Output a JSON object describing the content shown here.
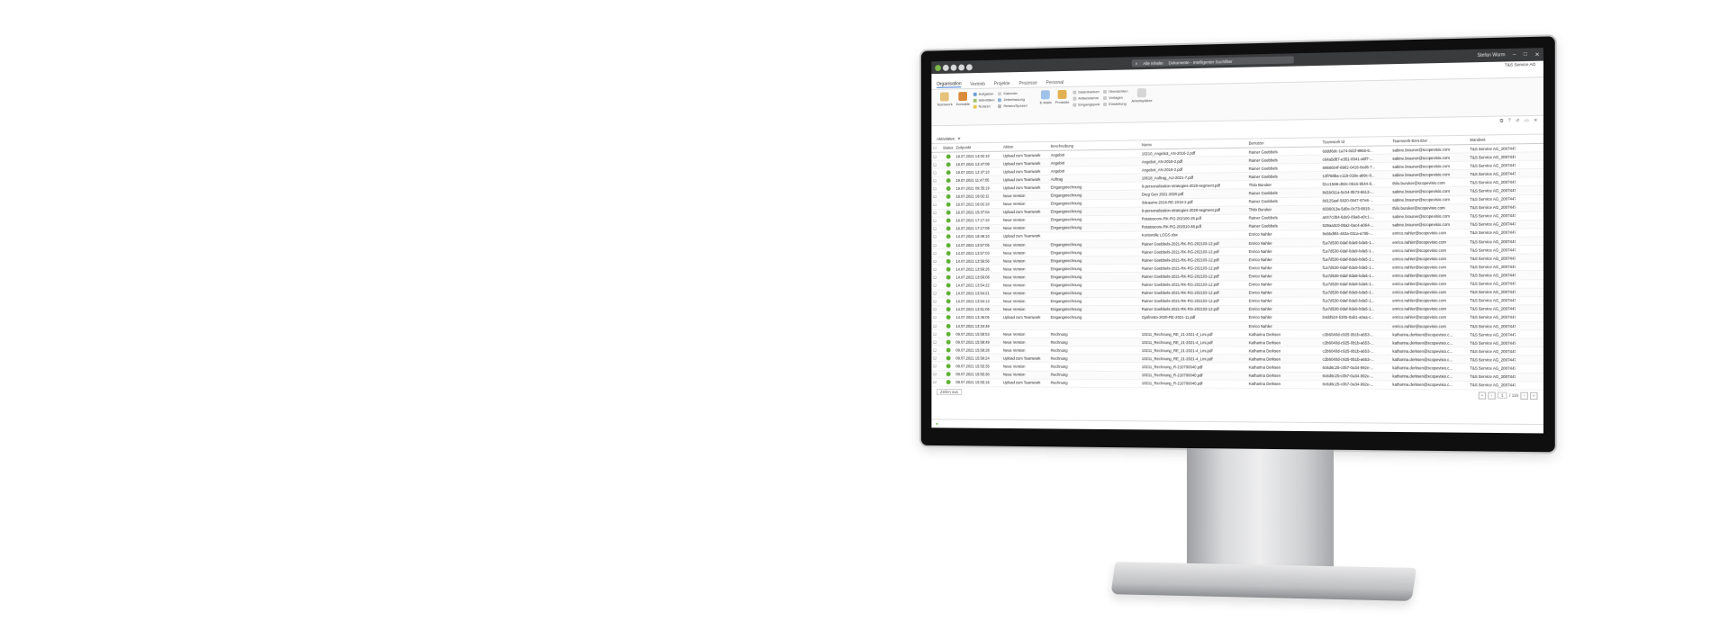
{
  "app": {
    "search_placeholder": "Alle Inhalte",
    "window_title": "Dokumente - Intelligenter Suchfilter",
    "user": "Stefan Wurm",
    "tenant": "T&S Service AG",
    "tabs": [
      "Organisation",
      "Vertrieb",
      "Projekte",
      "Prozesse",
      "Personal"
    ],
    "active_tab": "Organisation"
  },
  "ribbon": {
    "big1": "Teamwork",
    "big2": "Kontakte",
    "small_a": [
      "Aufgaben",
      "Aktivitäten",
      "Notizen"
    ],
    "small_b": [
      "Kalender",
      "Zeiterfassung",
      "Reisen/Spesen"
    ],
    "big3": "E-Mails",
    "big4": "Produkte",
    "small_c": [
      "Datenbanken",
      "Artikelstamm",
      "Eingangspost"
    ],
    "small_d": [
      "Übersichten",
      "Vorlagen",
      "Einstellung"
    ],
    "big5": "Arbeitsplätze"
  },
  "doc_tab": "Aktivitäten",
  "columns": {
    "status": "Status",
    "time": "Zeitpunkt",
    "action": "Aktion",
    "desc": "Beschreibung",
    "name": "Name",
    "user": "Benutzer",
    "tid": "Teamwork Id",
    "tuser": "Teamwork-Benutzer",
    "tenant": "Mandant"
  },
  "rows": [
    {
      "t": "19.07.2021 14:02:10",
      "a": "Upload zum Teamwork",
      "d": "Angebot",
      "n": "10210_Angebot_AN-2016-2.pdf",
      "u": "Rainer Goebbels",
      "id": "6ddd6dc-1a74-0d1f-8950-b...",
      "tu": "sabine.brauner@scopevisio.com",
      "m": "T&S Service AG_2007447"
    },
    {
      "t": "19.07.2021 13:47:08",
      "a": "Upload zum Teamwork",
      "d": "Angebot",
      "n": "Angebot_AN-2016-2.pdf",
      "u": "Rainer Goebbels",
      "id": "c64a5d87-e351-0041-a6f7-...",
      "tu": "sabine.brauner@scopevisio.com",
      "m": "T&S Service AG_2007447"
    },
    {
      "t": "19.07.2021 12:37:10",
      "a": "Upload zum Teamwork",
      "d": "Angebot",
      "n": "Angebot_AN-2016-2.pdf",
      "u": "Rainer Goebbels",
      "id": "6968604f-8982-0416-8ed6-7...",
      "tu": "sabine.brauner@scopevisio.com",
      "m": "T&S Service AG_2007447"
    },
    {
      "t": "19.07.2021 11:47:05",
      "a": "Upload zum Teamwork",
      "d": "Auftrag",
      "n": "10618_Auftrag_AU-2021-7.pdf",
      "u": "Rainer Goebbels",
      "id": "13f768ba-c118-018e-ab9c-0...",
      "tu": "sabine.brauner@scopevisio.com",
      "m": "T&S Service AG_2007447"
    },
    {
      "t": "19.07.2021 09:35:19",
      "a": "Upload zum Teamwork",
      "d": "Eingangsrechnung",
      "n": "9-personalization-strategies-2020-segment.pdf",
      "u": "Thilo Buruker",
      "id": "f2cc1568-d93c-0616-9544-9...",
      "tu": "thilo.buruker@scopevisio.com",
      "m": "T&S Service AG_2007447"
    },
    {
      "t": "16.07.2021 16:02:11",
      "a": "Neue Version",
      "d": "Eingangsrechnung",
      "n": "Dreg Gen 2021-2020.pdf",
      "u": "Rainer Goebbels",
      "id": "8d1b011a-5c04-0b73-6613-...",
      "tu": "sabine.brauner@scopevisio.com",
      "m": "T&S Service AG_2007447"
    },
    {
      "t": "16.07.2021 16:02:10",
      "a": "Neue Version",
      "d": "Eingangsrechnung",
      "n": "3deaams-2018-RE-2018-2.pdf",
      "u": "Rainer Goebbels",
      "id": "8d125aaf-5620-0947-87e8-...",
      "tu": "sabine.brauner@scopevisio.com",
      "m": "T&S Service AG_2007447"
    },
    {
      "t": "16.07.2021 15:37:04",
      "a": "Upload zum Teamwork",
      "d": "Eingangsrechnung",
      "n": "9-personalization-strategies-2020-segment.pdf",
      "u": "Thilo Buruker",
      "id": "8336013a-5d0e-0c73-6815-...",
      "tu": "thilo.buruker@scopevisio.com",
      "m": "T&S Service AG_2007447"
    },
    {
      "t": "16.07.2021 17:17:10",
      "a": "Neue Version",
      "d": "Eingangsrechnung",
      "n": "Rotatoscore-RK-RG-202100-25.pdf",
      "u": "Rainer Goebbels",
      "id": "a047c3b4-6de9-09a8-a0c1-...",
      "tu": "sabine.brauner@scopevisio.com",
      "m": "T&S Service AG_2007447"
    },
    {
      "t": "16.07.2021 17:17:09",
      "a": "Neue Version",
      "d": "Eingangsrechnung",
      "n": "Rotatoscore-RK-RG-202010-48.pdf",
      "u": "Rainer Goebbels",
      "id": "529aa3c0-08a2-0ac4-a064-...",
      "tu": "sabine.brauner@scopevisio.com",
      "m": "T&S Service AG_2007447"
    },
    {
      "t": "14.07.2021 19:49:10",
      "a": "Upload zum Teamwork",
      "d": "",
      "n": "Kontorolle LOGS.xlsx",
      "u": "Enrico Nahler",
      "id": "9ebbd9f4-463a-03ca-a795-...",
      "tu": "enrico.nahler@scopevisio.com",
      "m": "T&S Service AG_2007447"
    },
    {
      "t": "14.07.2021 13:57:05",
      "a": "Neue Version",
      "d": "Eingangsrechnung",
      "n": "Rainer Goebbels-2021-RK-RG-202103-12.pdf",
      "u": "Enrico Nahler",
      "id": "f1a7d530-0daf-0da9-bda5-1...",
      "tu": "enrico.nahler@scopevisio.com",
      "m": "T&S Service AG_2007447"
    },
    {
      "t": "14.07.2021 13:57:03",
      "a": "Neue Version",
      "d": "Eingangsrechnung",
      "n": "Rainer Goebbels-2021-RK-RG-202103-12.pdf",
      "u": "Enrico Nahler",
      "id": "f1a7d530-0daf-0da9-bda5-1...",
      "tu": "enrico.nahler@scopevisio.com",
      "m": "T&S Service AG_2007447"
    },
    {
      "t": "14.07.2021 13:56:56",
      "a": "Neue Version",
      "d": "Eingangsrechnung",
      "n": "Rainer Goebbels-2021-RK-RG-202103-12.pdf",
      "u": "Enrico Nahler",
      "id": "f1a7d530-0daf-0da9-bda5-1...",
      "tu": "enrico.nahler@scopevisio.com",
      "m": "T&S Service AG_2007447"
    },
    {
      "t": "14.07.2021 13:56:26",
      "a": "Neue Version",
      "d": "Eingangsrechnung",
      "n": "Rainer Goebbels-2021-RK-RG-202103-12.pdf",
      "u": "Enrico Nahler",
      "id": "f1a7d530-0daf-0da9-bda5-1...",
      "tu": "enrico.nahler@scopevisio.com",
      "m": "T&S Service AG_2007447"
    },
    {
      "t": "14.07.2021 13:56:08",
      "a": "Neue Version",
      "d": "Eingangsrechnung",
      "n": "Rainer Goebbels-2021-RK-RG-202103-12.pdf",
      "u": "Enrico Nahler",
      "id": "f1a7d530-0daf-0da9-bda5-1...",
      "tu": "enrico.nahler@scopevisio.com",
      "m": "T&S Service AG_2007447"
    },
    {
      "t": "14.07.2021 13:54:22",
      "a": "Neue Version",
      "d": "Eingangsrechnung",
      "n": "Rainer Goebbels-2021-RK-RG-202103-12.pdf",
      "u": "Enrico Nahler",
      "id": "f1a7d530-0daf-0da9-bda5-1...",
      "tu": "enrico.nahler@scopevisio.com",
      "m": "T&S Service AG_2007447"
    },
    {
      "t": "14.07.2021 13:54:21",
      "a": "Neue Version",
      "d": "Eingangsrechnung",
      "n": "Rainer Goebbels-2021-RK-RG-202103-12.pdf",
      "u": "Enrico Nahler",
      "id": "f1a7d530-0daf-0da9-bda5-1...",
      "tu": "enrico.nahler@scopevisio.com",
      "m": "T&S Service AG_2007447"
    },
    {
      "t": "14.07.2021 13:54:13",
      "a": "Neue Version",
      "d": "Eingangsrechnung",
      "n": "Rainer Goebbels-2021-RK-RG-202103-12.pdf",
      "u": "Enrico Nahler",
      "id": "f1a7d530-0daf-0da9-bda5-1...",
      "tu": "enrico.nahler@scopevisio.com",
      "m": "T&S Service AG_2007447"
    },
    {
      "t": "14.07.2021 13:51:05",
      "a": "Neue Version",
      "d": "Eingangsrechnung",
      "n": "Rainer Goebbels-2021-RK-RG-202103-12.pdf",
      "u": "Enrico Nahler",
      "id": "f1a7d530-0daf-0da9-bda5-1...",
      "tu": "enrico.nahler@scopevisio.com",
      "m": "T&S Service AG_2007447"
    },
    {
      "t": "14.07.2021 13:45:05",
      "a": "Upload zum Teamwork",
      "d": "Eingangsrechnung",
      "n": "Gjafirosto-2020-RE-2021-11.pdf",
      "u": "Enrico Nahler",
      "id": "b4dd524-5305-0ab1-a0aa-c...",
      "tu": "enrico.nahler@scopevisio.com",
      "m": "T&S Service AG_2007447"
    },
    {
      "t": "14.07.2021 13:34:49",
      "a": "",
      "d": "",
      "n": "",
      "u": "Enrico Nahler",
      "id": "",
      "tu": "enrico.nahler@scopevisio.com",
      "m": "T&S Service AG_2007447"
    },
    {
      "t": "09.07.2021 15:58:53",
      "a": "Neue Version",
      "d": "Rechnung",
      "n": "10211_Rechnung_RE_21-2021-4_Lmi.pdf",
      "u": "Katharina Derksen",
      "id": "c2b6040d-c925-0b1b-a653-...",
      "tu": "katharina.derksen@scopevisio.c...",
      "m": "T&S Service AG_2007447"
    },
    {
      "t": "09.07.2021 15:58:49",
      "a": "Neue Version",
      "d": "Rechnung",
      "n": "10211_Rechnung_RE_21-2021-4_Lmi.pdf",
      "u": "Katharina Derksen",
      "id": "c2b6040d-c925-0b1b-a653-...",
      "tu": "katharina.derksen@scopevisio.c...",
      "m": "T&S Service AG_2007447"
    },
    {
      "t": "09.07.2021 15:58:28",
      "a": "Neue Version",
      "d": "Rechnung",
      "n": "10211_Rechnung_RE_21-2021-4_Lmi.pdf",
      "u": "Katharina Derksen",
      "id": "c2b6040d-c925-0b1b-a653-...",
      "tu": "katharina.derksen@scopevisio.c...",
      "m": "T&S Service AG_2007447"
    },
    {
      "t": "09.07.2021 15:56:24",
      "a": "Upload zum Teamwork",
      "d": "Rechnung",
      "n": "10211_Rechnung_RE_21-2021-4_Lmi.pdf",
      "u": "Katharina Derksen",
      "id": "c2b6040d-c925-0b1b-a653-...",
      "tu": "katharina.derksen@scopevisio.c...",
      "m": "T&S Service AG_2007447"
    },
    {
      "t": "09.07.2021 15:55:35",
      "a": "Neue Version",
      "d": "Rechnung",
      "n": "10211_Rechnung_R-210700040.pdf",
      "u": "Katharina Derksen",
      "id": "6c6d6c25-c0b7-0a34-992e-...",
      "tu": "katharina.derksen@scopevisio.c...",
      "m": "T&S Service AG_2007447"
    },
    {
      "t": "09.07.2021 15:55:30",
      "a": "Neue Version",
      "d": "Rechnung",
      "n": "10211_Rechnung_R-210700040.pdf",
      "u": "Katharina Derksen",
      "id": "6c6d6c25-c0b7-0a34-992e-...",
      "tu": "katharina.derksen@scopevisio.c...",
      "m": "T&S Service AG_2007447"
    },
    {
      "t": "09.07.2021 15:55:16",
      "a": "Upload zum Teamwork",
      "d": "Rechnung",
      "n": "10211_Rechnung_R-210700040.pdf",
      "u": "Katharina Derksen",
      "id": "6c6d6c25-c0b7-0a34-992e-...",
      "tu": "katharina.derksen@scopevisio.c...",
      "m": "T&S Service AG_2007447"
    }
  ],
  "footer": {
    "filter_label": "Zeilen aus",
    "page_current": "1",
    "page_total": "/ 116"
  },
  "colors": {
    "titlebar": "#3a3b3d",
    "status_ok": "#5cb030",
    "accent": "#3a7bd5"
  }
}
